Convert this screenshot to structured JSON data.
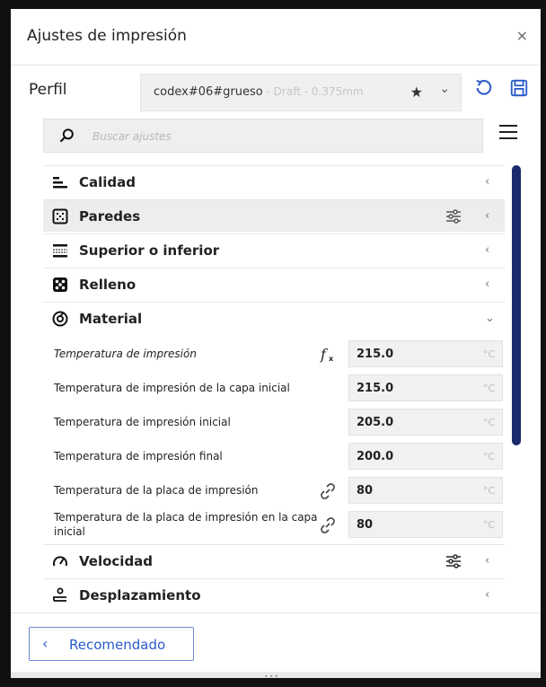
{
  "window": {
    "title": "Ajustes de impresión",
    "close_glyph": "×"
  },
  "profile": {
    "label": "Perfil",
    "name": "codex#06#grueso",
    "detail": " - Draft - 0.375mm",
    "star_glyph": "★",
    "chevron_glyph": "⌄",
    "reset_icon": "reset-icon",
    "save_icon": "save-icon"
  },
  "search": {
    "placeholder": "Buscar ajustes",
    "icon": "search-icon",
    "menu_icon": "hamburger-menu-icon"
  },
  "sections": [
    {
      "label": "Calidad",
      "icon": "quality-icon",
      "chevron": "‹",
      "has_adjust": false
    },
    {
      "label": "Paredes",
      "icon": "walls-icon",
      "chevron": "‹",
      "has_adjust": true
    },
    {
      "label": "Superior o inferior",
      "icon": "top-bottom-icon",
      "chevron": "‹",
      "has_adjust": false
    },
    {
      "label": "Relleno",
      "icon": "infill-icon",
      "chevron": "‹",
      "has_adjust": false
    },
    {
      "label": "Material",
      "icon": "material-icon",
      "chevron": "⌄",
      "has_adjust": false
    },
    {
      "label": "Velocidad",
      "icon": "speed-icon",
      "chevron": "‹",
      "has_adjust": true
    },
    {
      "label": "Desplazamiento",
      "icon": "travel-icon",
      "chevron": "‹",
      "has_adjust": false
    }
  ],
  "material_settings": [
    {
      "label": "Temperatura de impresión",
      "value": "215.0",
      "unit": "°C",
      "icon": "function-icon"
    },
    {
      "label": "Temperatura de impresión de la capa inicial",
      "value": "215.0",
      "unit": "°C"
    },
    {
      "label": "Temperatura de impresión inicial",
      "value": "205.0",
      "unit": "°C"
    },
    {
      "label": "Temperatura de impresión final",
      "value": "200.0",
      "unit": "°C"
    },
    {
      "label": "Temperatura de la placa de impresión",
      "value": "80",
      "unit": "°C",
      "icon": "link-icon"
    },
    {
      "label": "Temperatura de la placa de impresión en la capa inicial",
      "value": "80",
      "unit": "°C",
      "icon": "link-icon"
    }
  ],
  "footer": {
    "recommended_label": "Recomendado",
    "chevron_glyph": "‹"
  },
  "colors": {
    "accent": "#2a5bc9",
    "scrollbar": "#1b2a6b"
  }
}
